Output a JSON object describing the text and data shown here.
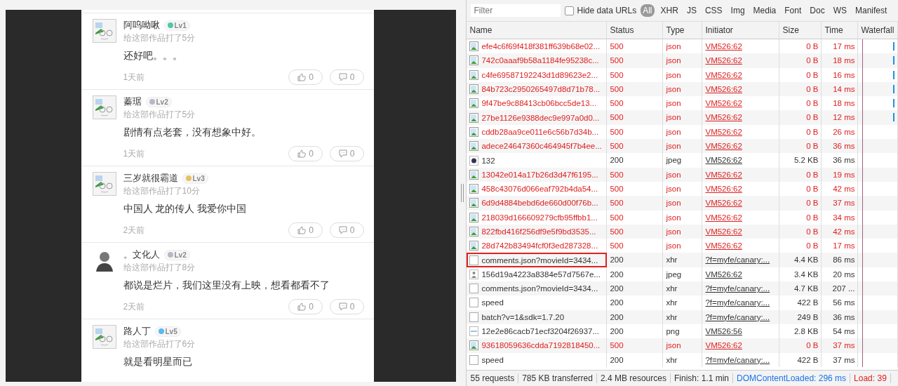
{
  "comments": [
    {
      "user": "阿呜呦啾",
      "level": "Lv1",
      "color": "#4fc8a8",
      "kind": "default",
      "score": "给这部作品打了5分",
      "text": "还好吧。。。",
      "time": "1天前",
      "likes": "0",
      "replies": "0"
    },
    {
      "user": "蓁琚",
      "level": "Lv2",
      "color": "#b8b8c8",
      "kind": "default",
      "score": "给这部作品打了5分",
      "text": "剧情有点老套，没有想象中好。",
      "time": "1天前",
      "likes": "0",
      "replies": "0"
    },
    {
      "user": "三岁就很霸道",
      "level": "Lv3",
      "color": "#e8c060",
      "kind": "default",
      "score": "给这部作品打了10分",
      "text": "中国人 龙的传人 我爱你中国",
      "time": "2天前",
      "likes": "0",
      "replies": "0"
    },
    {
      "user": "。文化人",
      "level": "Lv2",
      "color": "#b8b8c8",
      "kind": "portrait",
      "score": "给这部作品打了8分",
      "text": "都说是烂片，我们这里没有上映，想看都看不了",
      "time": "2天前",
      "likes": "0",
      "replies": "0"
    },
    {
      "user": "路人丁",
      "level": "Lv5",
      "color": "#5ab8f0",
      "kind": "default",
      "score": "给这部作品打了6分",
      "text": "就是看明星而已"
    }
  ],
  "devtools": {
    "filter": {
      "placeholder": "Filter"
    },
    "hide_data_urls": {
      "label": "Hide data URLs",
      "checked": false
    },
    "types": [
      {
        "label": "All",
        "selected": true
      },
      {
        "label": "XHR",
        "selected": false
      },
      {
        "label": "JS",
        "selected": false
      },
      {
        "label": "CSS",
        "selected": false
      },
      {
        "label": "Img",
        "selected": false
      },
      {
        "label": "Media",
        "selected": false
      },
      {
        "label": "Font",
        "selected": false
      },
      {
        "label": "Doc",
        "selected": false
      },
      {
        "label": "WS",
        "selected": false
      },
      {
        "label": "Manifest",
        "selected": false
      }
    ],
    "columns": [
      "Name",
      "Status",
      "Type",
      "Initiator",
      "Size",
      "Time",
      "Waterfall"
    ],
    "rows": [
      {
        "kind": "image",
        "name": "efe4c6f69f418f381ff639b68e02...",
        "status": "500",
        "type": "json",
        "initiator": "VM526:62",
        "size": "0 B",
        "time": "17 ms",
        "error": true,
        "highlighted": false,
        "tick": true
      },
      {
        "kind": "image",
        "name": "742c0aaaf9b58a1184fe95238c...",
        "status": "500",
        "type": "json",
        "initiator": "VM526:62",
        "size": "0 B",
        "time": "18 ms",
        "error": true,
        "highlighted": false,
        "tick": true
      },
      {
        "kind": "image",
        "name": "c4fe69587192243d1d89623e2...",
        "status": "500",
        "type": "json",
        "initiator": "VM526:62",
        "size": "0 B",
        "time": "16 ms",
        "error": true,
        "highlighted": false,
        "tick": true
      },
      {
        "kind": "image",
        "name": "84b723c2950265497d8d71b78...",
        "status": "500",
        "type": "json",
        "initiator": "VM526:62",
        "size": "0 B",
        "time": "14 ms",
        "error": true,
        "highlighted": false,
        "tick": true
      },
      {
        "kind": "image",
        "name": "9f47be9c88413cb06bcc5de13...",
        "status": "500",
        "type": "json",
        "initiator": "VM526:62",
        "size": "0 B",
        "time": "18 ms",
        "error": true,
        "highlighted": false,
        "tick": true
      },
      {
        "kind": "image",
        "name": "27be1126e9388dec9e997a0d0...",
        "status": "500",
        "type": "json",
        "initiator": "VM526:62",
        "size": "0 B",
        "time": "12 ms",
        "error": true,
        "highlighted": false,
        "tick": true
      },
      {
        "kind": "image",
        "name": "cddb28aa9ce011e6c56b7d34b...",
        "status": "500",
        "type": "json",
        "initiator": "VM526:62",
        "size": "0 B",
        "time": "26 ms",
        "error": true,
        "highlighted": false,
        "tick": false
      },
      {
        "kind": "image",
        "name": "adece24647360c464945f7b4ee...",
        "status": "500",
        "type": "json",
        "initiator": "VM526:62",
        "size": "0 B",
        "time": "36 ms",
        "error": true,
        "highlighted": false,
        "tick": false
      },
      {
        "kind": "photo",
        "name": "132",
        "status": "200",
        "type": "jpeg",
        "initiator": "VM526:62",
        "size": "5.2 KB",
        "time": "36 ms",
        "error": false,
        "highlighted": false,
        "tick": false
      },
      {
        "kind": "image",
        "name": "13042e014a17b26d3d47f6195...",
        "status": "500",
        "type": "json",
        "initiator": "VM526:62",
        "size": "0 B",
        "time": "19 ms",
        "error": true,
        "highlighted": false,
        "tick": false
      },
      {
        "kind": "image",
        "name": "458c43076d066eaf792b4da54...",
        "status": "500",
        "type": "json",
        "initiator": "VM526:62",
        "size": "0 B",
        "time": "42 ms",
        "error": true,
        "highlighted": false,
        "tick": false
      },
      {
        "kind": "image",
        "name": "6d9d4884bebd6de660d00f76b...",
        "status": "500",
        "type": "json",
        "initiator": "VM526:62",
        "size": "0 B",
        "time": "37 ms",
        "error": true,
        "highlighted": false,
        "tick": false
      },
      {
        "kind": "image",
        "name": "218039d166609279cfb95ffbb1...",
        "status": "500",
        "type": "json",
        "initiator": "VM526:62",
        "size": "0 B",
        "time": "34 ms",
        "error": true,
        "highlighted": false,
        "tick": false
      },
      {
        "kind": "image",
        "name": "822fbd416f256df9e5f9bd3535...",
        "status": "500",
        "type": "json",
        "initiator": "VM526:62",
        "size": "0 B",
        "time": "42 ms",
        "error": true,
        "highlighted": false,
        "tick": false
      },
      {
        "kind": "image",
        "name": "28d742b83494fcf0f3ed287328...",
        "status": "500",
        "type": "json",
        "initiator": "VM526:62",
        "size": "0 B",
        "time": "17 ms",
        "error": true,
        "highlighted": false,
        "tick": false
      },
      {
        "kind": "document",
        "name": "comments.json?movieId=3434...",
        "status": "200",
        "type": "xhr",
        "initiator": "?f=myfe/canary:...",
        "size": "4.4 KB",
        "time": "86 ms",
        "error": false,
        "highlighted": true,
        "tick": false
      },
      {
        "kind": "person",
        "name": "156d19a4223a8384e57d7567e...",
        "status": "200",
        "type": "jpeg",
        "initiator": "VM526:62",
        "size": "3.4 KB",
        "time": "20 ms",
        "error": false,
        "highlighted": false,
        "tick": false
      },
      {
        "kind": "document",
        "name": "comments.json?movieId=3434...",
        "status": "200",
        "type": "xhr",
        "initiator": "?f=myfe/canary:...",
        "size": "4.7 KB",
        "time": "207 ...",
        "error": false,
        "highlighted": false,
        "tick": false
      },
      {
        "kind": "document",
        "name": "speed",
        "status": "200",
        "type": "xhr",
        "initiator": "?f=myfe/canary:...",
        "size": "422 B",
        "time": "56 ms",
        "error": false,
        "highlighted": false,
        "tick": false
      },
      {
        "kind": "document",
        "name": "batch?v=1&sdk=1.7.20",
        "status": "200",
        "type": "xhr",
        "initiator": "?f=myfe/canary:...",
        "size": "249 B",
        "time": "36 ms",
        "error": false,
        "highlighted": false,
        "tick": false
      },
      {
        "kind": "png",
        "name": "12e2e86cacb71ecf3204f26937...",
        "status": "200",
        "type": "png",
        "initiator": "VM526:56",
        "size": "2.8 KB",
        "time": "54 ms",
        "error": false,
        "highlighted": false,
        "tick": false
      },
      {
        "kind": "image",
        "name": "93618059636cdda7192818450...",
        "status": "500",
        "type": "json",
        "initiator": "VM526:62",
        "size": "0 B",
        "time": "37 ms",
        "error": true,
        "highlighted": false,
        "tick": false
      },
      {
        "kind": "document",
        "name": "speed",
        "status": "200",
        "type": "xhr",
        "initiator": "?f=myfe/canary:...",
        "size": "422 B",
        "time": "37 ms",
        "error": false,
        "highlighted": false,
        "tick": false
      }
    ],
    "status_bar": [
      {
        "text": "55 requests",
        "kind": "plain"
      },
      {
        "text": "785 KB transferred",
        "kind": "plain"
      },
      {
        "text": "2.4 MB resources",
        "kind": "plain"
      },
      {
        "text": "Finish: 1.1 min",
        "kind": "plain"
      },
      {
        "text": "DOMContentLoaded: 296 ms",
        "kind": "dom"
      },
      {
        "text": "Load: 39",
        "kind": "load"
      }
    ]
  }
}
